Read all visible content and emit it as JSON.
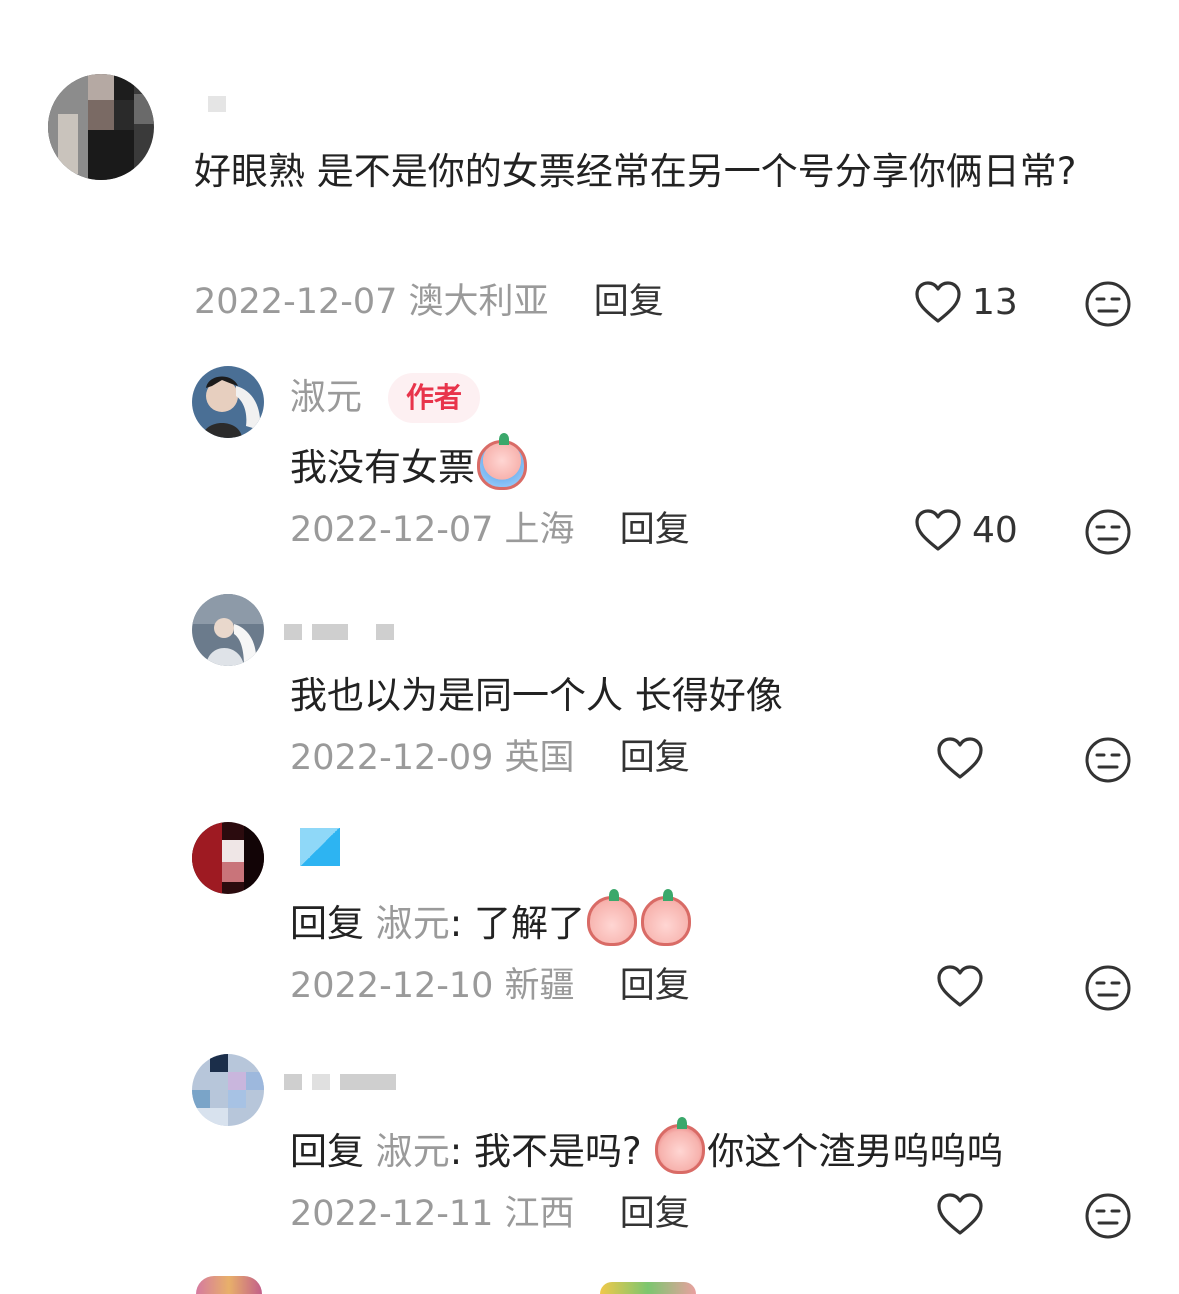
{
  "comments": [
    {
      "text_prefix": "好眼熟 ",
      "text": "是不是你的女票经常在另一个号分享你俩日常?",
      "date": "2022-12-07",
      "location": "澳大利亚",
      "reply_label": "回复",
      "likes": "13"
    },
    {
      "username": "淑元",
      "badge": "作者",
      "text": "我没有女票",
      "emoji": "crying-emoji",
      "date": "2022-12-07",
      "location": "上海",
      "reply_label": "回复",
      "likes": "40"
    },
    {
      "text": "我也以为是同一个人 长得好像",
      "date": "2022-12-09",
      "location": "英国",
      "reply_label": "回复",
      "likes": ""
    },
    {
      "reply_prefix": "回复",
      "reply_to": "淑元",
      "text": ": 了解了",
      "emoji": "surprised-emoji",
      "date": "2022-12-10",
      "location": "新疆",
      "reply_label": "回复",
      "likes": ""
    },
    {
      "reply_prefix": "回复",
      "reply_to": "淑元",
      "text": ": 我不是吗?",
      "text_after_emoji": "你这个渣男呜呜呜",
      "emoji": "shy-emoji",
      "date": "2022-12-11",
      "location": "江西",
      "reply_label": "回复",
      "likes": ""
    }
  ],
  "colors": {
    "badge_text": "#e8344b",
    "badge_bg": "#fdf0f2",
    "meta_text": "#9a9a9a",
    "body_text": "#222222"
  }
}
